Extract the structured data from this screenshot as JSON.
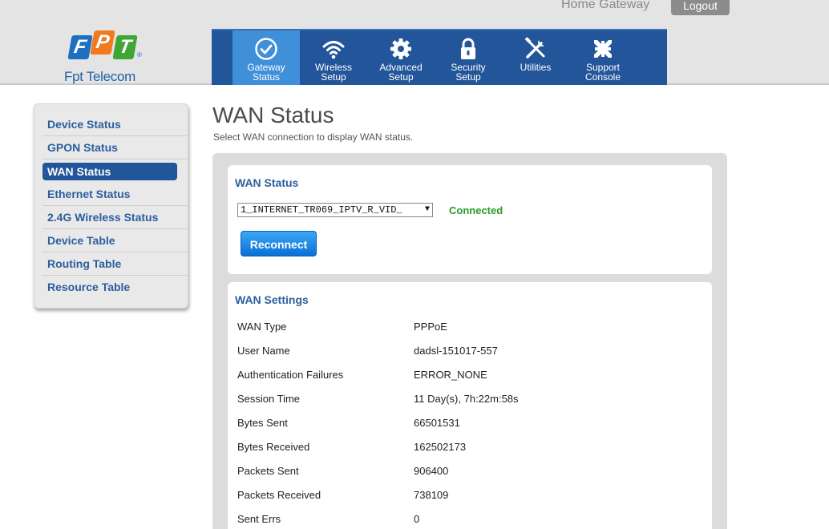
{
  "header": {
    "product": "Home Gateway",
    "logout_label": "Logout",
    "logo": {
      "letters": [
        "F",
        "P",
        "T"
      ],
      "reg": "®",
      "brand": "Fpt Telecom"
    }
  },
  "nav": [
    {
      "label1": "Gateway",
      "label2": "Status",
      "icon": "check-circle-icon",
      "active": true
    },
    {
      "label1": "Wireless",
      "label2": "Setup",
      "icon": "wifi-icon"
    },
    {
      "label1": "Advanced",
      "label2": "Setup",
      "icon": "gear-icon"
    },
    {
      "label1": "Security",
      "label2": "Setup",
      "icon": "lock-icon"
    },
    {
      "label1": "Utilities",
      "label2": "",
      "icon": "tools-icon"
    },
    {
      "label1": "Support",
      "label2": "Console",
      "icon": "compress-arrows-icon"
    }
  ],
  "sidebar": {
    "items": [
      {
        "label": "Device Status"
      },
      {
        "label": "GPON Status"
      },
      {
        "label": "WAN Status",
        "active": true
      },
      {
        "label": "Ethernet Status"
      },
      {
        "label": "2.4G Wireless Status"
      },
      {
        "label": "Device Table"
      },
      {
        "label": "Routing Table"
      },
      {
        "label": "Resource Table"
      }
    ]
  },
  "main": {
    "title": "WAN Status",
    "subtitle": "Select WAN connection to display WAN status.",
    "status_card": {
      "title": "WAN Status",
      "connection": "1_INTERNET_TR069_IPTV_R_VID_",
      "state": "Connected",
      "reconnect_label": "Reconnect"
    },
    "settings_card": {
      "title": "WAN Settings",
      "rows": [
        {
          "label": "WAN Type",
          "value": "PPPoE"
        },
        {
          "label": "User Name",
          "value": "dadsl-151017-557"
        },
        {
          "label": "Authentication Failures",
          "value": "ERROR_NONE"
        },
        {
          "label": "Session Time",
          "value": "11 Day(s), 7h:22m:58s"
        },
        {
          "label": "Bytes Sent",
          "value": "66501531"
        },
        {
          "label": "Bytes Received",
          "value": "162502173"
        },
        {
          "label": "Packets Sent",
          "value": "906400"
        },
        {
          "label": "Packets Received",
          "value": "738109"
        },
        {
          "label": "Sent Errs",
          "value": "0"
        }
      ]
    }
  },
  "colors": {
    "nav_bg": "#22559a",
    "nav_active": "#3f8fd9",
    "link_blue": "#2b5e9e",
    "connected_green": "#2a9c2a"
  }
}
